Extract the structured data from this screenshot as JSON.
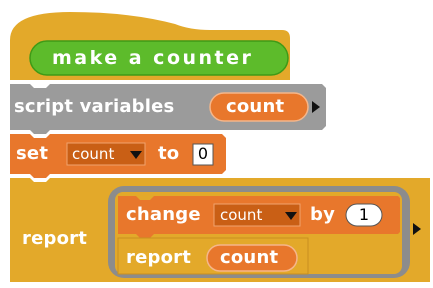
{
  "script": {
    "hat_block": {
      "label": "make a counter"
    },
    "script_variables_block": {
      "label": "script variables",
      "variable": "count"
    },
    "set_block": {
      "label": "set",
      "variable": "count",
      "to_label": "to",
      "value": "0"
    },
    "report_block": {
      "label": "report",
      "ring": {
        "change_block": {
          "label": "change",
          "variable": "count",
          "by_label": "by",
          "value": "1"
        },
        "inner_report_block": {
          "label": "report",
          "variable": "count"
        }
      }
    }
  },
  "colors": {
    "control": "#e3a92a",
    "variables": "#e8772c",
    "variables_dark": "#c95f15",
    "other": "#9b9b9b",
    "hat_pill": "#5dbb2b",
    "ring": "#8c8c8c"
  },
  "icons": [
    "dropdown-arrow-icon",
    "expand-arrow-icon"
  ]
}
